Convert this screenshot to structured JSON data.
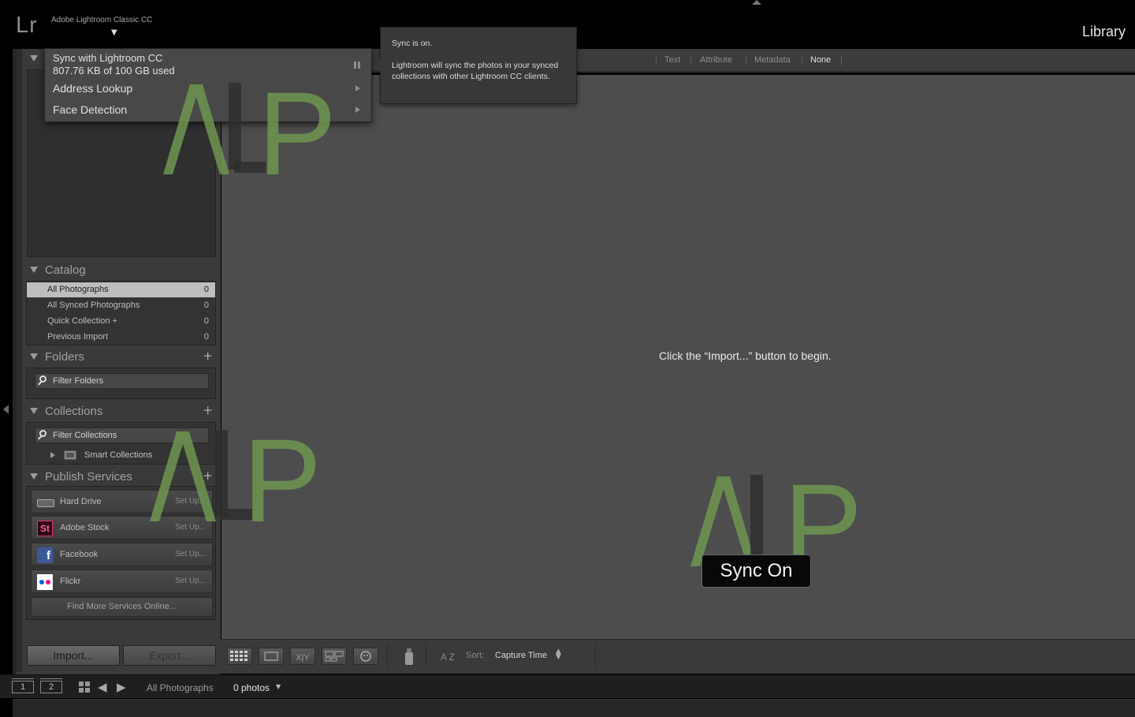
{
  "app": {
    "logo": "Lr",
    "name": "Adobe Lightroom Classic CC",
    "module": "Library"
  },
  "identity_menu": {
    "sync_title": "Sync with Lightroom CC",
    "sync_usage": "807.76 KB of 100 GB used",
    "address_lookup": "Address Lookup",
    "face_detection": "Face Detection"
  },
  "sync_tooltip": {
    "title": "Sync is on.",
    "body": "Lightroom will sync the photos in your synced collections with other Lightroom CC clients."
  },
  "left_panel": {
    "catalog": {
      "title": "Catalog",
      "items": [
        {
          "label": "All Photographs",
          "count": "0"
        },
        {
          "label": "All Synced Photographs",
          "count": "0"
        },
        {
          "label": "Quick Collection  +",
          "count": "0"
        },
        {
          "label": "Previous Import",
          "count": "0"
        }
      ]
    },
    "folders": {
      "title": "Folders",
      "add": "+",
      "filter_placeholder": "Filter Folders"
    },
    "collections": {
      "title": "Collections",
      "add": "+",
      "filter_placeholder": "Filter Collections",
      "smart": "Smart Collections"
    },
    "publish": {
      "title": "Publish Services",
      "add": "+",
      "services": [
        {
          "label": "Hard Drive",
          "action": "Set Up...",
          "icon": "hard-drive-icon"
        },
        {
          "label": "Adobe Stock",
          "action": "Set Up...",
          "icon": "adobe-stock-icon",
          "glyph": "St"
        },
        {
          "label": "Facebook",
          "action": "Set Up...",
          "icon": "facebook-icon",
          "glyph": "f"
        },
        {
          "label": "Flickr",
          "action": "Set Up...",
          "icon": "flickr-icon"
        }
      ],
      "find_more": "Find More Services Online..."
    },
    "import_label": "Import...",
    "export_label": "Export..."
  },
  "filter_bar": {
    "items": [
      "Text",
      "Attribute",
      "Metadata",
      "None"
    ],
    "active": "None"
  },
  "main": {
    "empty_message": "Click the “Import...” button to begin."
  },
  "toolbar": {
    "sort_label": "Sort:",
    "sort_value": "Capture Time",
    "compare_label": "X|Y",
    "sort_az": "A Z"
  },
  "filmstrip": {
    "screen1": "1",
    "screen2": "2",
    "source": "All Photographs",
    "count": "0 photos"
  },
  "badge": {
    "text": "Sync On"
  },
  "watermark": {
    "text": "P",
    "color": "#6e9650"
  },
  "colors": {
    "selected_row": "#bebebe",
    "grid_bg": "#4d4d4d",
    "panel_bg": "#3a3a3a"
  }
}
